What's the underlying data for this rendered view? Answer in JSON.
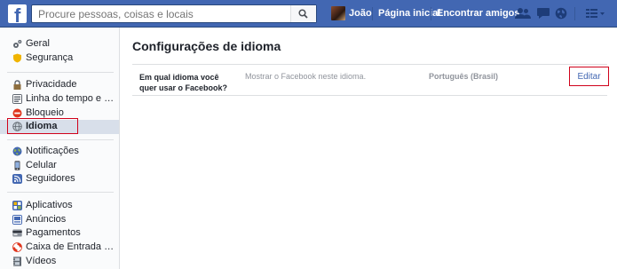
{
  "topbar": {
    "logo_letter": "f",
    "search_placeholder": "Procure pessoas, coisas e locais",
    "user_name": "João",
    "home_label": "Página inicial",
    "find_friends_label": "Encontrar amigos",
    "colors": {
      "bar": "#4267b2",
      "border": "#29487d"
    }
  },
  "sidebar": {
    "items": [
      {
        "label": "Geral",
        "icon": "gear-icon",
        "color": "#7f7f7f"
      },
      {
        "label": "Segurança",
        "icon": "shield-icon",
        "color": "#f0b400"
      },
      {
        "label": "Privacidade",
        "icon": "lock-icon",
        "color": "#7f7f7f"
      },
      {
        "label": "Linha do tempo e marc...",
        "icon": "timeline-icon",
        "color": "#7f7f7f"
      },
      {
        "label": "Bloqueio",
        "icon": "block-icon",
        "color": "#e0371f"
      },
      {
        "label": "Idioma",
        "icon": "globe-icon",
        "color": "#7f7f7f",
        "selected": true
      },
      {
        "label": "Notificações",
        "icon": "globe-notifications-icon",
        "color": "#4267b2"
      },
      {
        "label": "Celular",
        "icon": "phone-icon",
        "color": "#4267b2"
      },
      {
        "label": "Seguidores",
        "icon": "rss-icon",
        "color": "#4267b2"
      },
      {
        "label": "Aplicativos",
        "icon": "apps-icon",
        "color": "#4267b2"
      },
      {
        "label": "Anúncios",
        "icon": "ads-icon",
        "color": "#4267b2"
      },
      {
        "label": "Pagamentos",
        "icon": "card-icon",
        "color": "#7f7f7f"
      },
      {
        "label": "Caixa de Entrada de Su...",
        "icon": "lifebuoy-icon",
        "color": "#e0371f"
      },
      {
        "label": "Vídeos",
        "icon": "film-icon",
        "color": "#7f7f7f"
      }
    ]
  },
  "main": {
    "title": "Configurações de idioma",
    "setting": {
      "question": "Em qual idioma você quer usar o Facebook?",
      "description": "Mostrar o Facebook neste idioma.",
      "value": "Português (Brasil)",
      "edit_label": "Editar"
    }
  }
}
